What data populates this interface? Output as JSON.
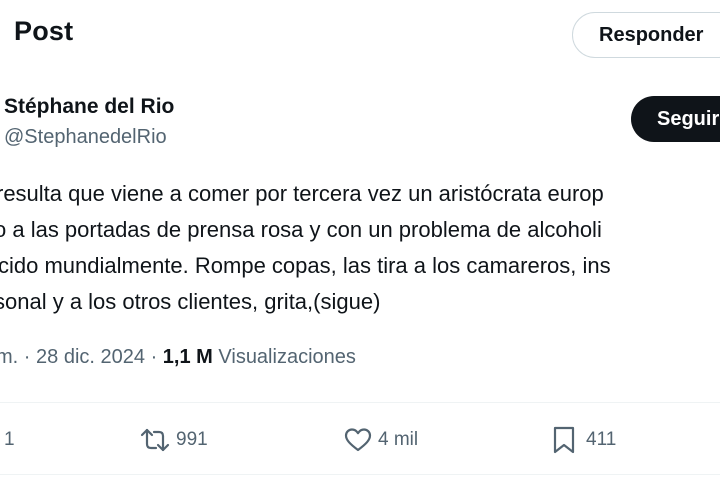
{
  "header": {
    "title": "Post",
    "reply_label": "Responder"
  },
  "author": {
    "name": "Stéphane del Rio",
    "handle": "@StephanedelRio",
    "follow_label": "Seguir"
  },
  "tweet": {
    "lines": [
      "resulta que viene a comer por tercera vez un aristócrata europ",
      "o a las portadas de prensa rosa y con un problema de alcoholi",
      "cido mundialmente. Rompe copas, las tira a los camareros, ins",
      "sonal y a los otros clientes, grita,(sigue)"
    ]
  },
  "meta": {
    "time": "m.",
    "separator": "·",
    "date": "28 dic. 2024",
    "views_count": "1,1 M",
    "views_label": "Visualizaciones"
  },
  "actions": {
    "replies": "1",
    "reposts": "991",
    "likes": "4 mil",
    "bookmarks": "411"
  },
  "icons": {
    "repost": "repost-icon",
    "like": "heart-icon",
    "bookmark": "bookmark-icon"
  },
  "colors": {
    "text": "#0f1419",
    "secondary": "#536471",
    "border": "#cfd9de",
    "divider": "#eff3f4",
    "follow_bg": "#0f1419"
  }
}
